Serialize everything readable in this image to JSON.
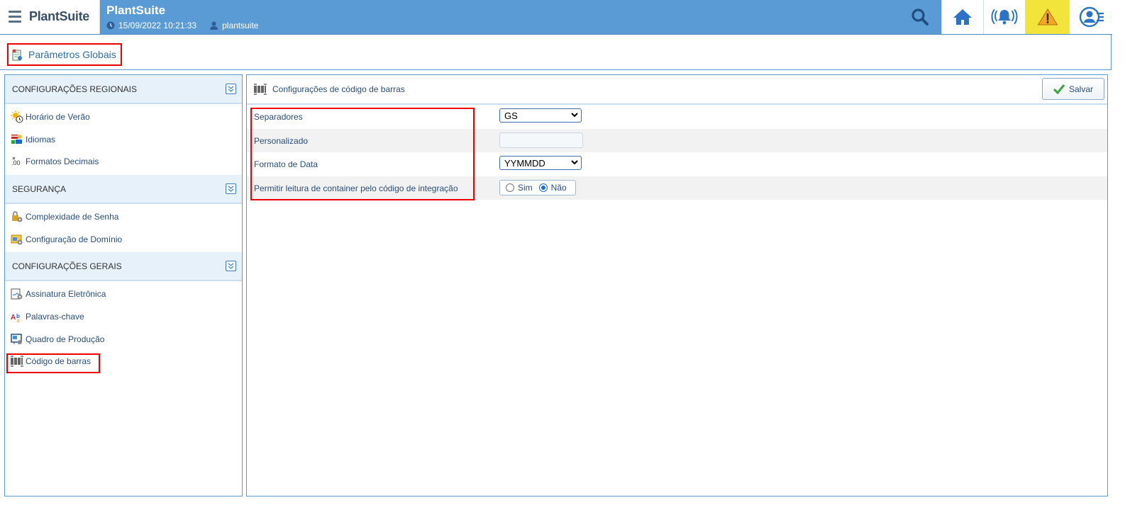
{
  "header": {
    "brand": "PlantSuite",
    "app_title": "PlantSuite",
    "datetime": "15/09/2022 10:21:33",
    "username": "plantsuite"
  },
  "page": {
    "title": "Parâmetros Globais"
  },
  "sidebar": {
    "sections": [
      {
        "title": "CONFIGURAÇÕES REGIONAIS",
        "items": [
          {
            "label": "Horário de Verão",
            "icon": "sun-clock-icon"
          },
          {
            "label": "Idiomas",
            "icon": "flags-icon"
          },
          {
            "label": "Formatos Decimais",
            "icon": "decimal-icon"
          }
        ]
      },
      {
        "title": "SEGURANÇA",
        "items": [
          {
            "label": "Complexidade de Senha",
            "icon": "lock-gear-icon"
          },
          {
            "label": "Configuração de Domínio",
            "icon": "domain-icon"
          }
        ]
      },
      {
        "title": "CONFIGURAÇÕES GERAIS",
        "items": [
          {
            "label": "Assinatura Eletrônica",
            "icon": "signature-icon"
          },
          {
            "label": "Palavras-chave",
            "icon": "keywords-icon"
          },
          {
            "label": "Quadro de Produção",
            "icon": "production-board-icon"
          },
          {
            "label": "Código de barras",
            "icon": "barcode-icon"
          }
        ]
      }
    ]
  },
  "main": {
    "title": "Configurações de código de barras",
    "save_label": "Salvar",
    "fields": {
      "separadores": {
        "label": "Separadores",
        "value": "GS"
      },
      "personalizado": {
        "label": "Personalizado",
        "value": ""
      },
      "formato_data": {
        "label": "Formato de Data",
        "value": "YYMMDD"
      },
      "permitir": {
        "label": "Permitir leitura de container pelo código de integração",
        "option_yes": "Sim",
        "option_no": "Não",
        "selected": "Não"
      }
    }
  },
  "colors": {
    "topbar": "#5b9bd5",
    "alert": "#f2e43a",
    "highlight": "#e00000",
    "link": "#2a4e78"
  }
}
